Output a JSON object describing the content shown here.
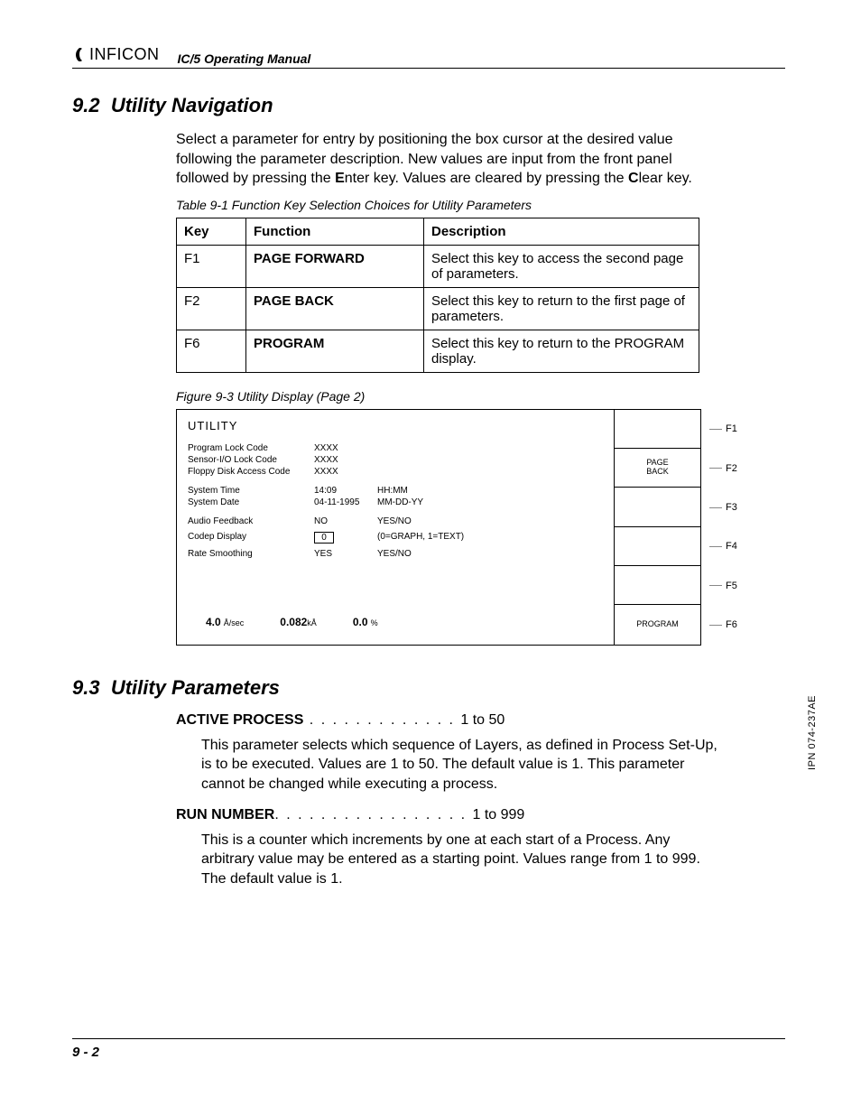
{
  "header": {
    "brand": "INFICON",
    "manual": "IC/5 Operating Manual"
  },
  "sec92": {
    "num": "9.2",
    "title": "Utility Navigation",
    "intro_a": "Select a parameter for entry by positioning the box cursor at the desired value following the parameter description. New values are input from the front panel followed by pressing the ",
    "intro_e": "E",
    "intro_mid": "nter key. Values are cleared by pressing the ",
    "intro_c": "C",
    "intro_end": "lear key.",
    "table_caption": "Table 9-1  Function Key Selection Choices for Utility Parameters",
    "th": {
      "key": "Key",
      "func": "Function",
      "desc": "Description"
    },
    "rows": [
      {
        "k": "F1",
        "f": "PAGE FORWARD",
        "d": "Select this key to access the second page of parameters."
      },
      {
        "k": "F2",
        "f": "PAGE BACK",
        "d": "Select this key to return to the first page of parameters."
      },
      {
        "k": "F6",
        "f": "PROGRAM",
        "d": "Select this key to return to the PROGRAM display."
      }
    ],
    "fig_caption": "Figure 9-3  Utility Display (Page 2)",
    "fig": {
      "title": "UTILITY",
      "rows": [
        {
          "l": "Program Lock Code",
          "v": "XXXX",
          "h": ""
        },
        {
          "l": "Sensor-I/O Lock Code",
          "v": "XXXX",
          "h": ""
        },
        {
          "l": "Floppy Disk Access Code",
          "v": "XXXX",
          "h": ""
        }
      ],
      "rows2": [
        {
          "l": "System Time",
          "v": "14:09",
          "h": "HH:MM"
        },
        {
          "l": "System Date",
          "v": "04-11-1995",
          "h": "MM-DD-YY"
        }
      ],
      "rows3": [
        {
          "l": "Audio Feedback",
          "v": "NO",
          "h": "YES/NO"
        },
        {
          "l": "Codep Display",
          "v": "0",
          "h": "(0=GRAPH, 1=TEXT)",
          "boxed": true
        },
        {
          "l": "Rate Smoothing",
          "v": "YES",
          "h": "YES/NO"
        }
      ],
      "status": {
        "r1v": "4.0",
        "r1u": "Å/sec",
        "r2v": "0.082",
        "r2u": "kÅ",
        "r3v": "0.0",
        "r3u": "%"
      },
      "side": [
        "",
        "PAGE BACK",
        "",
        "",
        "",
        "PROGRAM"
      ],
      "fkeys": [
        "F1",
        "F2",
        "F3",
        "F4",
        "F5",
        "F6"
      ]
    }
  },
  "sec93": {
    "num": "9.3",
    "title": "Utility Parameters",
    "params": [
      {
        "name": "ACTIVE PROCESS",
        "dots": " . . . . . . . . . . . . . ",
        "range": "1 to 50",
        "desc": "This parameter selects which sequence of Layers, as defined in Process Set-Up, is to be executed. Values are 1 to 50. The default value is 1. This parameter cannot be changed while executing a process."
      },
      {
        "name": "RUN NUMBER",
        "dots": ". . . . . . . . . . . . . . . . . ",
        "range": "1 to 999",
        "desc": "This is a counter which increments by one at each start of a Process. Any arbitrary value may be entered as a starting point. Values range from 1 to 999. The default value is 1."
      }
    ]
  },
  "footer": {
    "page": "9 - 2",
    "ipn": "IPN 074-237AE"
  }
}
